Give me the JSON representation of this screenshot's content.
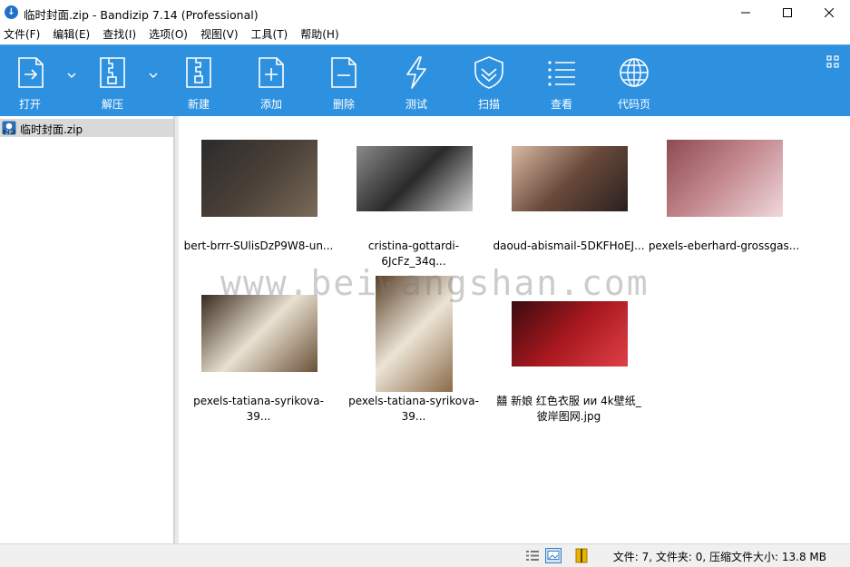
{
  "window": {
    "title": "临时封面.zip - Bandizip 7.14 (Professional)",
    "icon": "bandizip-logo-icon",
    "accent": "#2e91e0"
  },
  "menu": [
    "文件(F)",
    "编辑(E)",
    "查找(I)",
    "选项(O)",
    "视图(V)",
    "工具(T)",
    "帮助(H)"
  ],
  "toolbar": {
    "open": "打开",
    "extract": "解压",
    "new": "新建",
    "add": "添加",
    "delete": "删除",
    "test": "测试",
    "scan": "扫描",
    "view": "查看",
    "codepage": "代码页"
  },
  "tree": {
    "archive": "临时封面.zip"
  },
  "files": [
    {
      "name": "bert-brrr-SUlisDzP9W8-un...",
      "colors": [
        "#2b2b2b",
        "#4a4038",
        "#7a6a58"
      ]
    },
    {
      "name": "cristina-gottardi-6JcFz_34q...",
      "colors": [
        "#8a8a8a",
        "#2a2a2a",
        "#d0d0d0"
      ]
    },
    {
      "name": "daoud-abismail-5DKFHoEJ...",
      "colors": [
        "#d9b9a4",
        "#6a4a3a",
        "#2a2020"
      ]
    },
    {
      "name": "pexels-eberhard-grossgas...",
      "colors": [
        "#8e4a52",
        "#c48a90",
        "#f0d8dc"
      ]
    },
    {
      "name": "pexels-tatiana-syrikova-39...",
      "colors": [
        "#3a2a1e",
        "#e8e0d0",
        "#6a5038"
      ]
    },
    {
      "name": "pexels-tatiana-syrikova-39...",
      "colors": [
        "#5a4028",
        "#ece4d6",
        "#8a6a48"
      ]
    },
    {
      "name": "囍 新娘 红色衣服 ᴎᴎ 4k壁纸_\n彼岸图网.jpg",
      "colors": [
        "#3a0c10",
        "#a8181e",
        "#e04048"
      ]
    }
  ],
  "watermark": "www.beiwangshan.com",
  "status": {
    "summary": "文件: 7, 文件夹: 0, 压缩文件大小: 13.8 MB"
  }
}
